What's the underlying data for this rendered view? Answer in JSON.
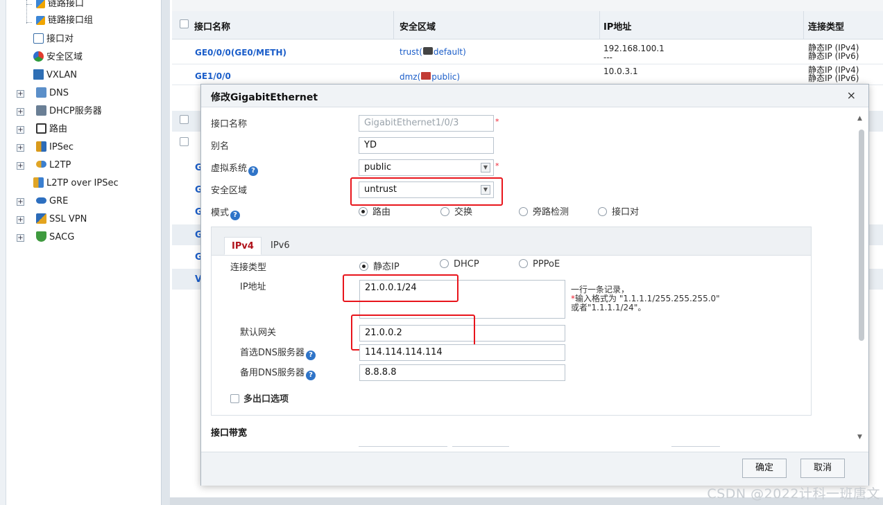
{
  "sidebar": {
    "items": [
      {
        "label": "链路接口",
        "icon": "link-interface-icon"
      },
      {
        "label": "链路接口组",
        "icon": "link-group-icon"
      },
      {
        "label": "接口对",
        "icon": "interface-pair-icon"
      },
      {
        "label": "安全区域",
        "icon": "security-zone-icon"
      },
      {
        "label": "VXLAN",
        "icon": "vxlan-icon"
      },
      {
        "label": "DNS",
        "icon": "dns-icon"
      },
      {
        "label": "DHCP服务器",
        "icon": "dhcp-icon"
      },
      {
        "label": "路由",
        "icon": "route-icon"
      },
      {
        "label": "IPSec",
        "icon": "ipsec-icon"
      },
      {
        "label": "L2TP",
        "icon": "l2tp-icon"
      },
      {
        "label": "L2TP over IPSec",
        "icon": "l2tp-ipsec-icon"
      },
      {
        "label": "GRE",
        "icon": "gre-icon"
      },
      {
        "label": "SSL VPN",
        "icon": "sslvpn-icon"
      },
      {
        "label": "SACG",
        "icon": "sacg-icon"
      }
    ],
    "expander": "+"
  },
  "table": {
    "headers": [
      "接口名称",
      "安全区域",
      "IP地址",
      "连接类型"
    ],
    "rows": [
      {
        "name": "GE0/0/0(GE0/METH)",
        "zone": "trust(",
        "zone2": "default)",
        "ip": "192.168.100.1",
        "ip2": "---",
        "type1": "静态IP (IPv4)",
        "type2": "静态IP (IPv6)"
      },
      {
        "name": "GE1/0/0",
        "zone": "dmz(",
        "zone2": "public)",
        "ip": "10.0.3.1",
        "type1": "静态IP (IPv4)",
        "type2": "静态IP (IPv6)"
      }
    ],
    "partial_rows": [
      "G",
      "G",
      "G",
      "G",
      "G",
      "V"
    ]
  },
  "dialog": {
    "title": "修改GigabitEthernet",
    "close": "×",
    "fields": {
      "interface_name": {
        "label": "接口名称",
        "value": "GigabitEthernet1/0/3"
      },
      "alias": {
        "label": "别名",
        "value": "YD"
      },
      "vsys": {
        "label": "虚拟系统",
        "value": "public"
      },
      "zone": {
        "label": "安全区域",
        "value": "untrust"
      },
      "mode": {
        "label": "模式",
        "options": [
          "路由",
          "交换",
          "旁路检测",
          "接口对"
        ],
        "selected": "路由"
      }
    },
    "help_glyph": "?",
    "required_mark": "*",
    "tabs": [
      "IPv4",
      "IPv6"
    ],
    "active_tab": "IPv4",
    "ipv4": {
      "conn_type_label": "连接类型",
      "conn_options": [
        "静态IP",
        "DHCP",
        "PPPoE"
      ],
      "conn_selected": "静态IP",
      "ip_label": "IP地址",
      "ip_value": "21.0.0.1/24",
      "ip_hint": [
        "一行一条记录，",
        "输入格式为 \"1.1.1.1/255.255.255.0\"",
        "或者\"1.1.1.1/24\"。"
      ],
      "ip_hint_star": "*",
      "gateway_label": "默认网关",
      "gateway_value": "21.0.0.2",
      "dns1_label": "首选DNS服务器",
      "dns1_value": "114.114.114.114",
      "dns2_label": "备用DNS服务器",
      "dns2_value": "8.8.8.8",
      "multi_exit_label": "多出口选项"
    },
    "bandwidth_label": "接口带宽",
    "ok_label": "确定",
    "cancel_label": "取消"
  },
  "watermark": "CSDN @2022计科一班唐文",
  "colors": {
    "link": "#1a5dc9",
    "active_tab": "#b0121b",
    "highlight": "#e8141b",
    "help": "#2f74c8"
  }
}
